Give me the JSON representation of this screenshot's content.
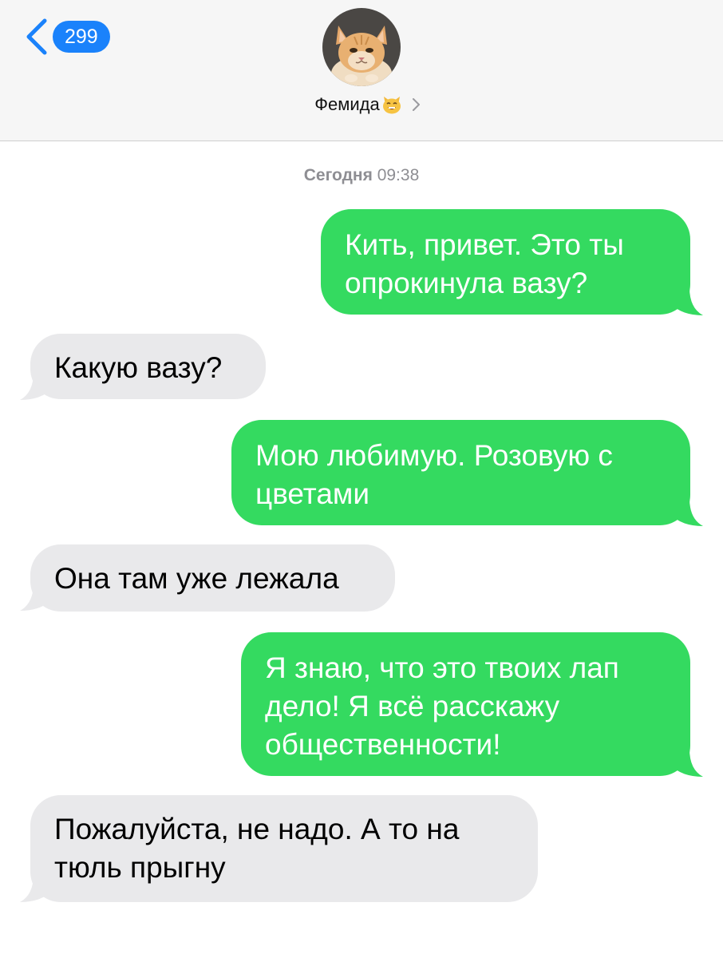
{
  "header": {
    "back_count": "299",
    "contact_name": "Фемида"
  },
  "timestamp": {
    "day": "Сегодня",
    "time": "09:38"
  },
  "messages": [
    {
      "direction": "outgoing",
      "text": "Кить, привет. Это ты опрокинула вазу?"
    },
    {
      "direction": "incoming",
      "text": "Какую вазу?"
    },
    {
      "direction": "outgoing",
      "text": "Мою любимую. Розовую с цветами"
    },
    {
      "direction": "incoming",
      "text": "Она там уже лежала"
    },
    {
      "direction": "outgoing",
      "text": "Я знаю, что это твоих лап дело! Я всё расскажу общественности!"
    },
    {
      "direction": "incoming",
      "text": "Пожалуйста, не надо. А то на тюль прыгну"
    }
  ],
  "icons": {
    "back": "chevron-left-icon",
    "contact_emoji": "cat-face-emoji-icon",
    "contact_chevron": "chevron-right-icon"
  },
  "colors": {
    "outgoing_bubble": "#34da60",
    "incoming_bubble": "#e9e9eb",
    "accent": "#1a82fb"
  }
}
